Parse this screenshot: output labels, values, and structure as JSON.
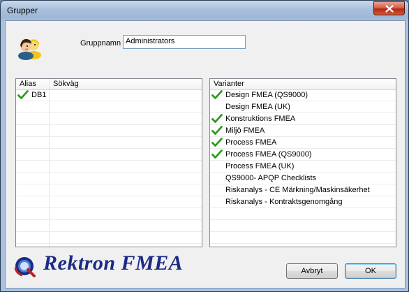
{
  "window": {
    "title": "Grupper",
    "title_ghost": "Grupper"
  },
  "icons": {
    "close": "close-icon",
    "group": "users-group-icon",
    "check": "checkmark-icon",
    "logo": "rektron-logo-icon"
  },
  "form": {
    "group_name_label": "Gruppnamn",
    "group_name_value": "Administrators"
  },
  "alias_list": {
    "headers": [
      "Alias",
      "Sökväg"
    ],
    "rows": [
      {
        "alias": "DB1",
        "path": "",
        "checked": true
      }
    ]
  },
  "variants": {
    "header": "Varianter",
    "items": [
      {
        "label": "Design FMEA (QS9000)",
        "checked": true
      },
      {
        "label": "Design FMEA (UK)",
        "checked": false
      },
      {
        "label": "Konstruktions FMEA",
        "checked": true
      },
      {
        "label": "Miljö FMEA",
        "checked": true
      },
      {
        "label": "Process FMEA",
        "checked": true
      },
      {
        "label": "Process FMEA (QS9000)",
        "checked": true
      },
      {
        "label": "Process FMEA (UK)",
        "checked": false
      },
      {
        "label": "QS9000- APQP Checklists",
        "checked": false
      },
      {
        "label": "Riskanalys - CE Märkning/Maskinsäkerhet",
        "checked": false
      },
      {
        "label": "Riskanalys - Kontraktsgenomgång",
        "checked": false
      }
    ]
  },
  "branding": {
    "logo_text": "Rektron FMEA"
  },
  "buttons": {
    "cancel": "Avbryt",
    "ok": "OK"
  },
  "colors": {
    "check_green": "#2e9a1e",
    "logo_blue": "#1b2a86"
  }
}
